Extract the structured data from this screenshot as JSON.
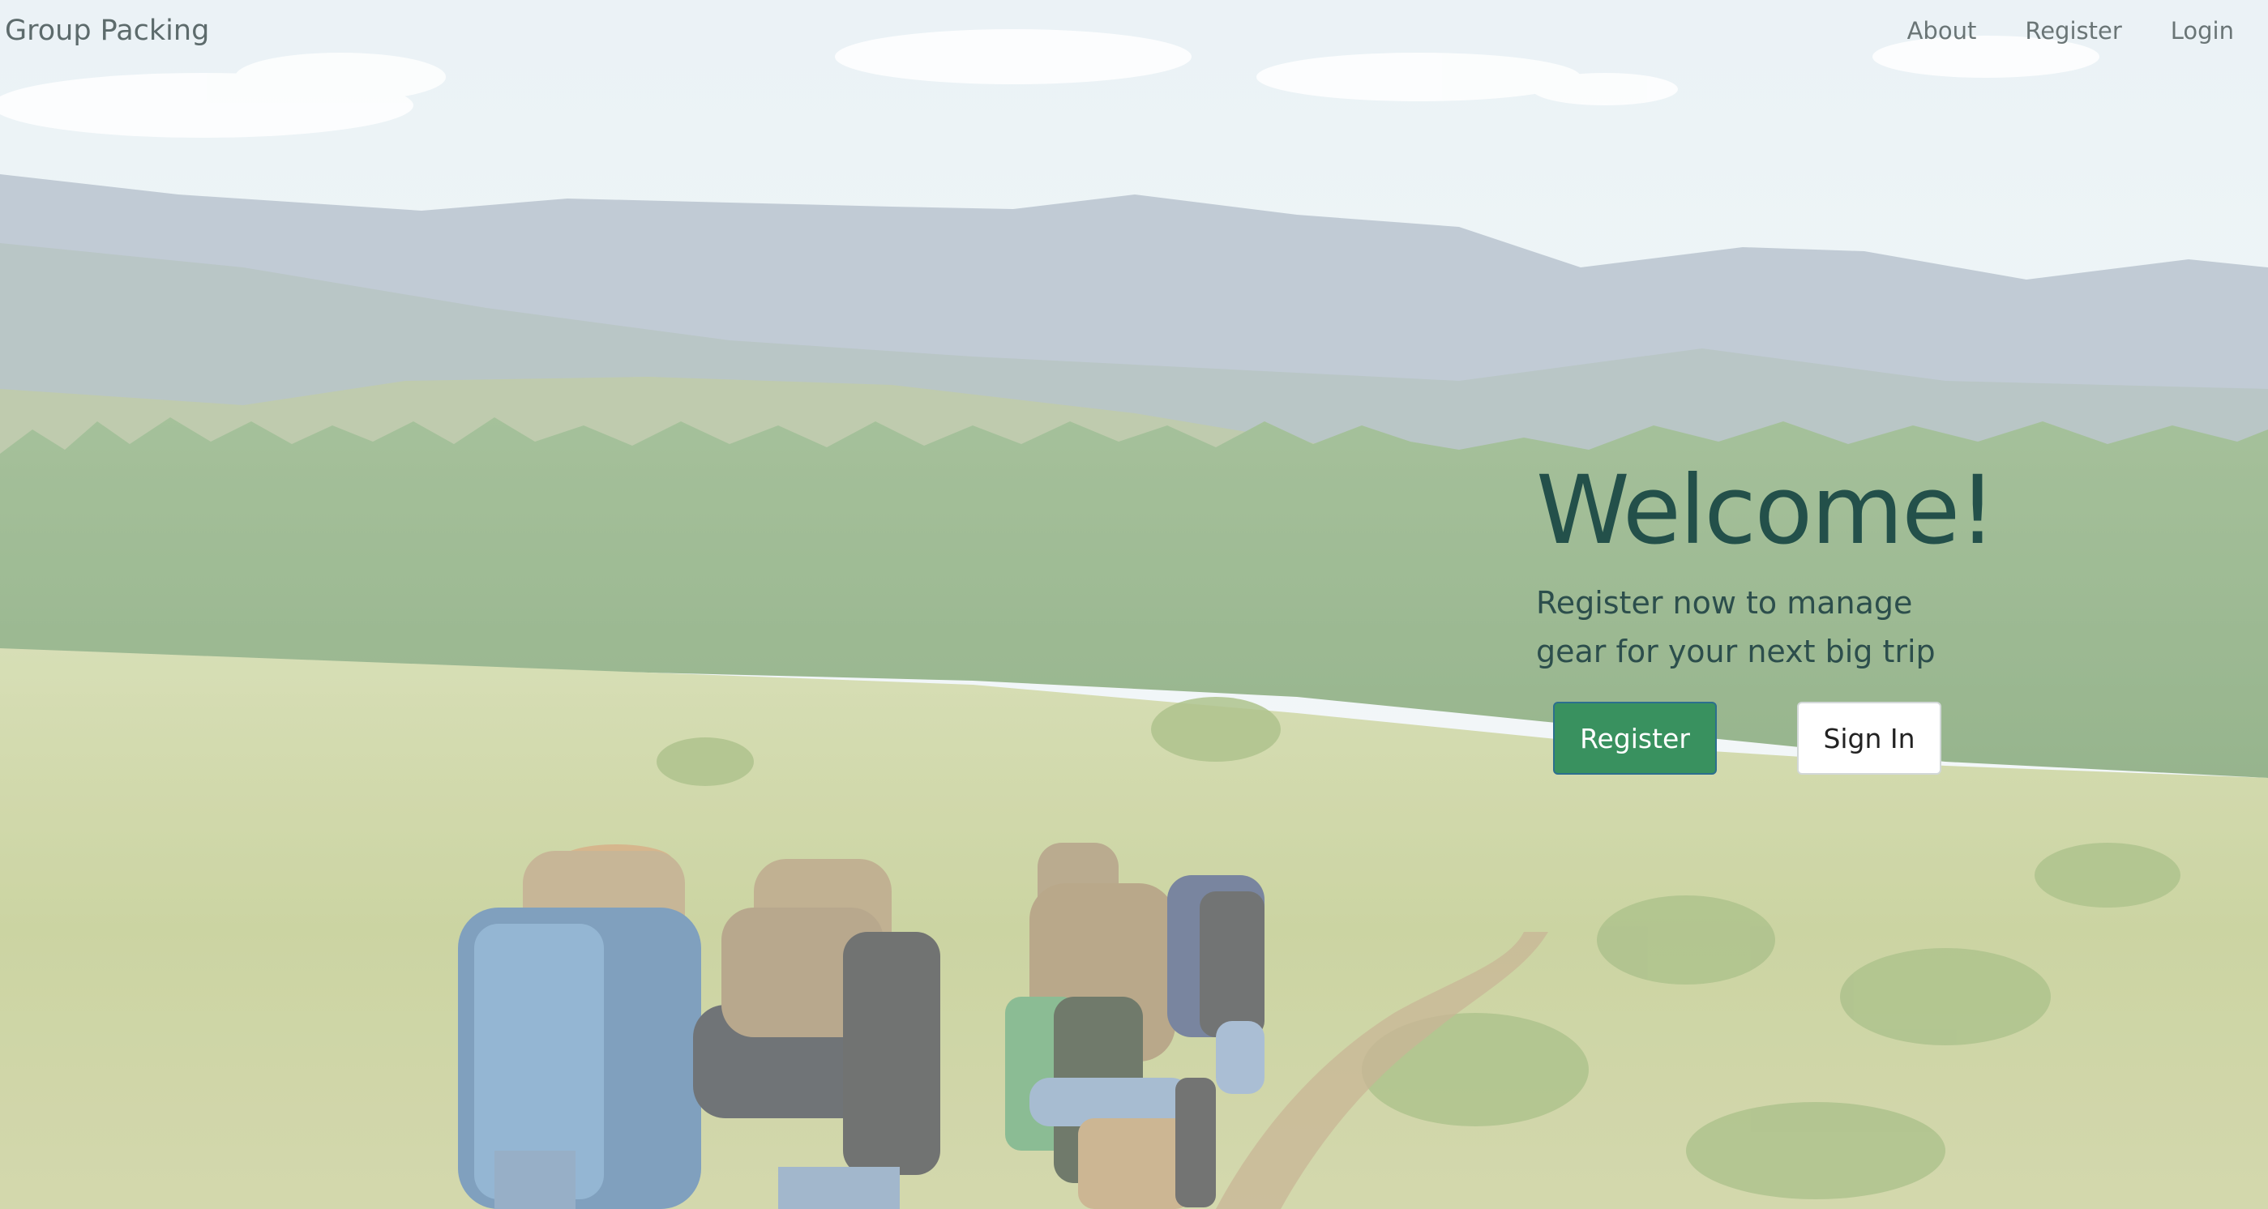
{
  "navbar": {
    "brand": "Group Packing",
    "links": [
      "About",
      "Register",
      "Login"
    ]
  },
  "hero": {
    "title": "Welcome!",
    "subtitle": "Register now to manage gear for your next big trip",
    "primary_button": "Register",
    "secondary_button": "Sign In"
  },
  "colors": {
    "primary_button": "#39915f",
    "title": "#23504a",
    "sky": "#eef5f7",
    "forest": "#5f8d53",
    "meadow": "#c5cf92"
  },
  "background_image": "hikers-with-backpacks-on-meadow-trail"
}
